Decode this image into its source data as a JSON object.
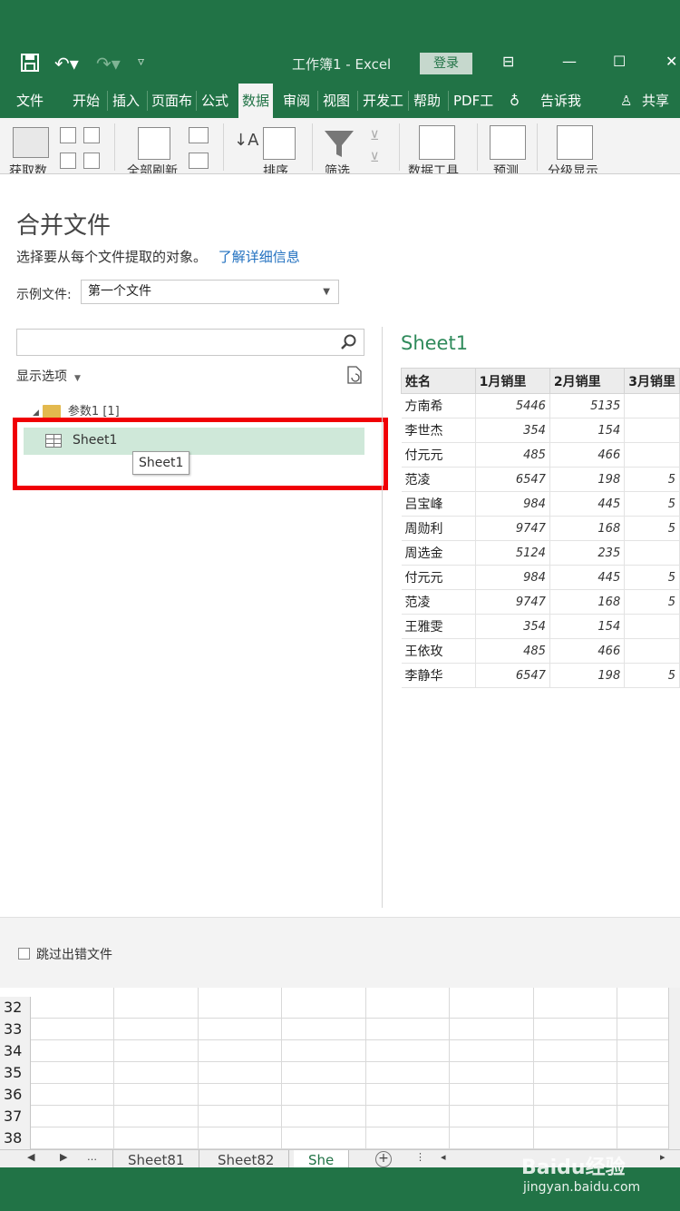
{
  "titlebar": {
    "doc_title": "工作簿1  -  Excel",
    "login_label": "登录",
    "colors": {
      "brand": "#217346"
    }
  },
  "ribbon_tabs": [
    {
      "label": "文件"
    },
    {
      "label": "开始"
    },
    {
      "label": "插入"
    },
    {
      "label": "页面布"
    },
    {
      "label": "公式"
    },
    {
      "label": "数据"
    },
    {
      "label": "审阅"
    },
    {
      "label": "视图"
    },
    {
      "label": "开发工"
    },
    {
      "label": "帮助"
    },
    {
      "label": "PDF工"
    },
    {
      "label": "告诉我"
    },
    {
      "label": "共享"
    }
  ],
  "ribbon_groups": {
    "get_data": "获取数",
    "refresh_all": "全部刷新",
    "sort": "排序",
    "filter": "筛选",
    "data_tools": "数据工具",
    "forecast": "预测",
    "outline": "分级显示"
  },
  "dialog": {
    "title": "合并文件",
    "description": "选择要从每个文件提取的对象。",
    "learn_more": "了解详细信息",
    "example_label": "示例文件:",
    "example_value": "第一个文件",
    "show_options": "显示选项",
    "tree_folder": "参数1 [1]",
    "tree_item": "Sheet1",
    "tooltip": "Sheet1",
    "skip_errors": "跳过出错文件"
  },
  "preview": {
    "title": "Sheet1",
    "columns": [
      "姓名",
      "1月销里",
      "2月销里",
      "3月销里"
    ],
    "rows": [
      [
        "方南希",
        "5446",
        "5135",
        ""
      ],
      [
        "李世杰",
        "354",
        "154",
        ""
      ],
      [
        "付元元",
        "485",
        "466",
        ""
      ],
      [
        "范凌",
        "6547",
        "198",
        "5"
      ],
      [
        "吕宝峰",
        "984",
        "445",
        "5"
      ],
      [
        "周勋利",
        "9747",
        "168",
        "5"
      ],
      [
        "周选金",
        "5124",
        "235",
        ""
      ],
      [
        "付元元",
        "984",
        "445",
        "5"
      ],
      [
        "范凌",
        "9747",
        "168",
        "5"
      ],
      [
        "王雅雯",
        "354",
        "154",
        ""
      ],
      [
        "王依玫",
        "485",
        "466",
        ""
      ],
      [
        "李静华",
        "6547",
        "198",
        "5"
      ]
    ]
  },
  "sheet": {
    "row_numbers": [
      "32",
      "33",
      "34",
      "35",
      "36",
      "37",
      "38"
    ],
    "tabs": [
      "Sheet81",
      "Sheet82",
      "She"
    ]
  },
  "watermark": {
    "brand": "Baidu经验",
    "url": "jingyan.baidu.com"
  }
}
